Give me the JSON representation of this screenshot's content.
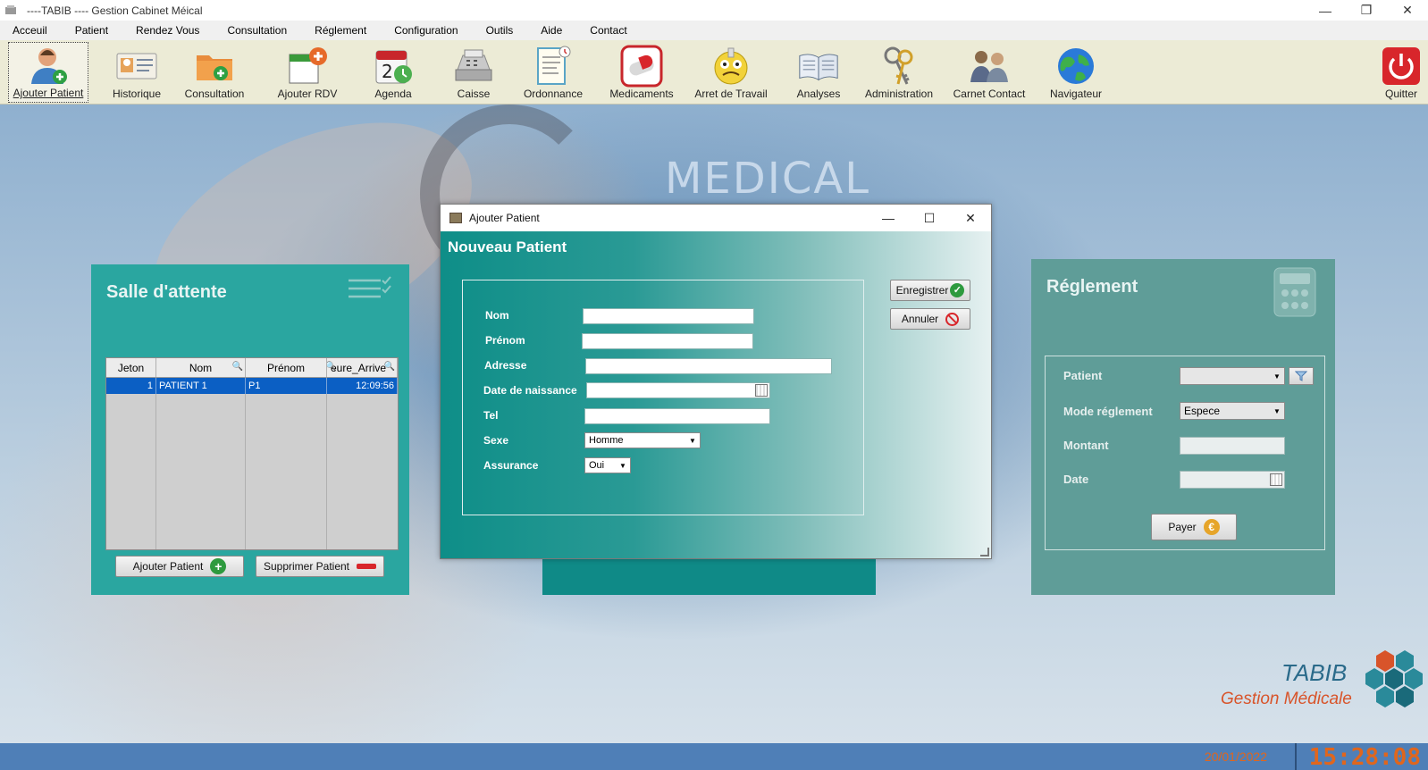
{
  "window": {
    "title": "----TABIB ---- Gestion Cabinet Méical"
  },
  "menu": [
    "Acceuil",
    "Patient",
    "Rendez Vous",
    "Consultation",
    "Réglement",
    "Configuration",
    "Outils",
    "Aide",
    "Contact"
  ],
  "toolbar": {
    "ajouter_patient": "Ajouter Patient",
    "historique": "Historique",
    "consultation": "Consultation",
    "ajouter_rdv": "Ajouter RDV",
    "agenda": "Agenda",
    "caisse": "Caisse",
    "ordonnance": "Ordonnance",
    "medicaments": "Medicaments",
    "arret_de_travail": "Arret de Travail",
    "analyses": "Analyses",
    "administration": "Administration",
    "carnet_contact": "Carnet Contact",
    "navigateur": "Navigateur",
    "quitter": "Quitter"
  },
  "background": {
    "text": "MEDICAL"
  },
  "salle": {
    "title": "Salle d'attente",
    "columns": [
      "Jeton",
      "Nom",
      "Prénom",
      "eure_Arrive"
    ],
    "rows": [
      {
        "jeton": "1",
        "nom": "PATIENT 1",
        "prenom": "P1",
        "heure": "12:09:56"
      }
    ],
    "add_button": "Ajouter Patient",
    "delete_button": "Supprimer Patient"
  },
  "reglement": {
    "title": "Réglement",
    "patient_label": "Patient",
    "mode_label": "Mode réglement",
    "mode_value": "Espece",
    "montant_label": "Montant",
    "date_label": "Date",
    "pay_button": "Payer"
  },
  "dialog": {
    "title": "Ajouter Patient",
    "heading": "Nouveau Patient",
    "labels": {
      "nom": "Nom",
      "prenom": "Prénom",
      "adresse": "Adresse",
      "date_naissance": "Date de naissance",
      "tel": "Tel",
      "sexe": "Sexe",
      "assurance": "Assurance"
    },
    "sexe_value": "Homme",
    "assurance_value": "Oui",
    "save_button": "Enregistrer",
    "cancel_button": "Annuler"
  },
  "logo": {
    "name": "TABIB",
    "tagline": "Gestion Médicale"
  },
  "status": {
    "date": "20/01/2022",
    "time": "15:28:08"
  },
  "colors": {
    "teal": "#2aa6a0",
    "reglement_bg": "#5f9d98",
    "status_bar": "#4f7fb7",
    "clock": "#e0661d"
  }
}
